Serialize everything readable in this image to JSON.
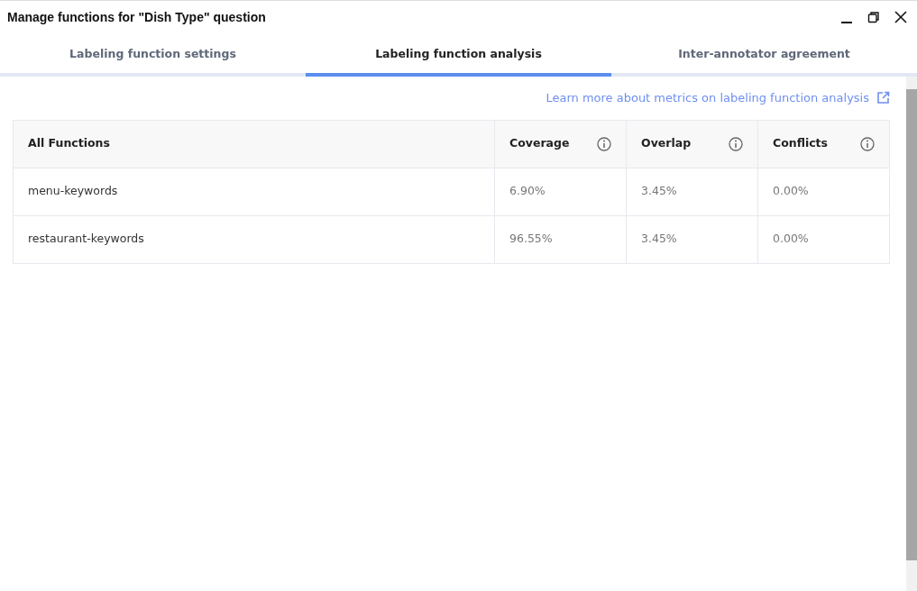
{
  "window": {
    "title": "Manage functions for \"Dish Type\" question"
  },
  "tabs": [
    {
      "label": "Labeling function settings",
      "selected": false
    },
    {
      "label": "Labeling function analysis",
      "selected": true
    },
    {
      "label": "Inter-annotator agreement",
      "selected": false
    }
  ],
  "link": "Learn more about metrics on labeling function analysis",
  "table": {
    "columns": [
      {
        "label": "All Functions",
        "info": false
      },
      {
        "label": "Coverage",
        "info": true
      },
      {
        "label": "Overlap",
        "info": true
      },
      {
        "label": "Conflicts",
        "info": true
      }
    ],
    "rows": [
      [
        "menu-keywords",
        "6.90%",
        "3.45%",
        "0.00%"
      ],
      [
        "restaurant-keywords",
        "96.55%",
        "3.45%",
        "0.00%"
      ]
    ]
  }
}
